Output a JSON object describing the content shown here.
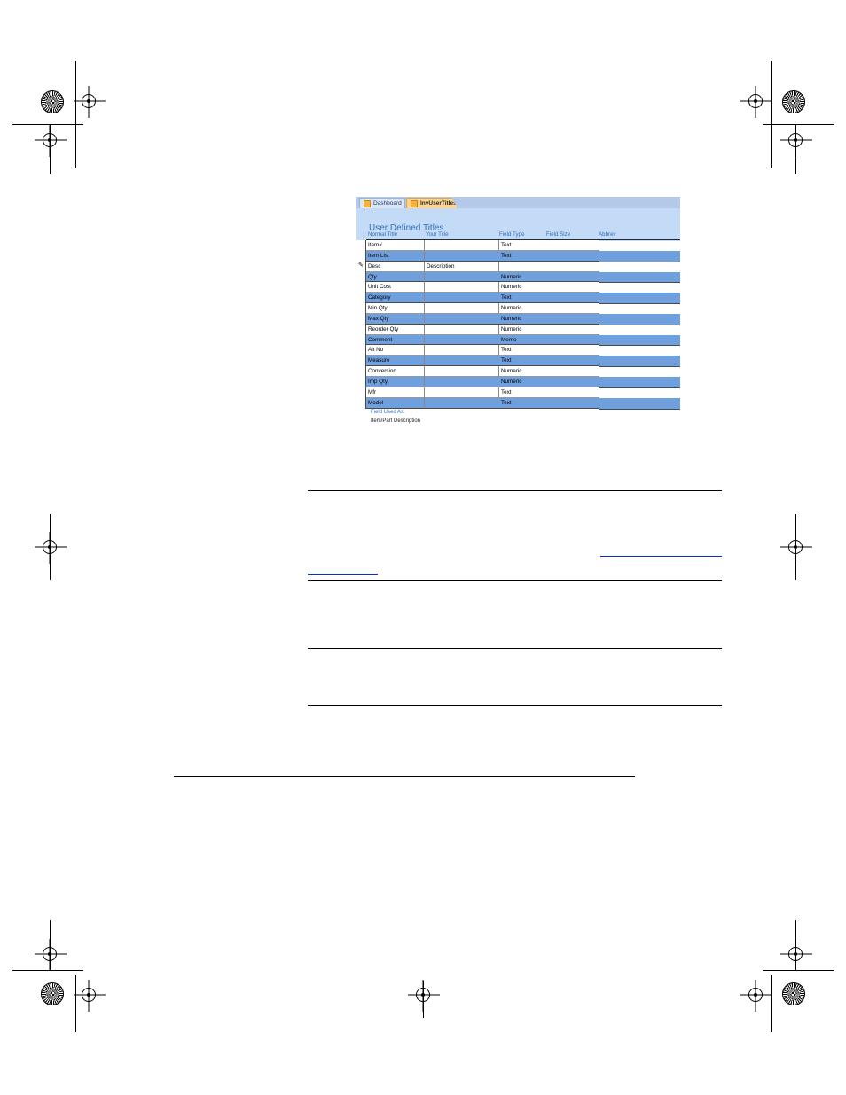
{
  "tabs": [
    {
      "label": "Dashboard"
    },
    {
      "label": "InvUserTitles"
    }
  ],
  "form": {
    "title": "User Defined Titles",
    "columns": [
      "Normal Title",
      "Your Title",
      "Field Type",
      "Field Size",
      "Abbrev"
    ],
    "rows": [
      {
        "normal": "Item#",
        "yours": "",
        "type": "Text"
      },
      {
        "normal": "Item List",
        "yours": "",
        "type": "Text"
      },
      {
        "normal": "Desc",
        "yours": "Description",
        "type": ""
      },
      {
        "normal": "Qty",
        "yours": "",
        "type": "Numeric"
      },
      {
        "normal": "Unit Cost",
        "yours": "",
        "type": "Numeric"
      },
      {
        "normal": "Category",
        "yours": "",
        "type": "Text"
      },
      {
        "normal": "Min Qty",
        "yours": "",
        "type": "Numeric"
      },
      {
        "normal": "Max Qty",
        "yours": "",
        "type": "Numeric"
      },
      {
        "normal": "Reorder Qty",
        "yours": "",
        "type": "Numeric"
      },
      {
        "normal": "Comment",
        "yours": "",
        "type": "Memo"
      },
      {
        "normal": "Alt No",
        "yours": "",
        "type": "Text"
      },
      {
        "normal": "Measure",
        "yours": "",
        "type": "Text"
      },
      {
        "normal": "Conversion",
        "yours": "",
        "type": "Numeric"
      },
      {
        "normal": "Imp Qty",
        "yours": "",
        "type": "Numeric"
      },
      {
        "normal": "Mfr",
        "yours": "",
        "type": "Text"
      },
      {
        "normal": "Model",
        "yours": "",
        "type": "Text"
      }
    ],
    "footer": {
      "label": "Field Used As:",
      "value": "Item/Part Description"
    }
  },
  "colors": {
    "band": "#6f9fdd",
    "header_bg": "#c4dbf7",
    "title": "#2d6fc3",
    "active_tab": "#fcd38f"
  }
}
